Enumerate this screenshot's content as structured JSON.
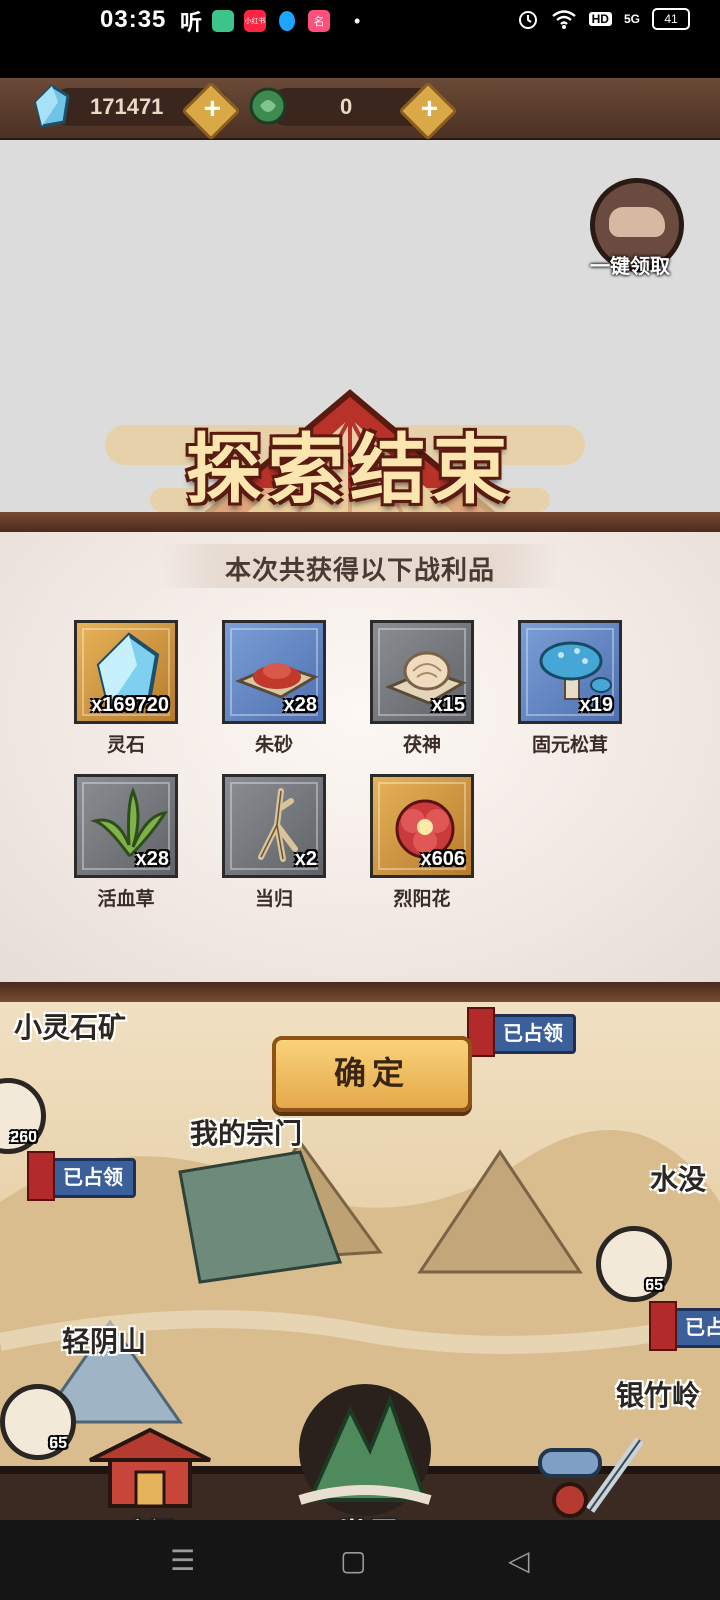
{
  "statusbar": {
    "time": "03:35",
    "listen_glyph": "听",
    "app_icons": [
      {
        "name": "green-app-icon",
        "color": "#3cc48a",
        "glyph": ""
      },
      {
        "name": "xiaohongshu-icon",
        "color": "#ff2442",
        "glyph": "小红书"
      },
      {
        "name": "qq-icon",
        "color": "#1ea5ff",
        "glyph": ""
      },
      {
        "name": "pink-app-icon",
        "color": "#ff4f7d",
        "glyph": "名"
      }
    ],
    "hd_label": "HD",
    "network": "5G",
    "battery": "41"
  },
  "resources": {
    "spirit_stone": "171471",
    "jade": "0",
    "plus": "+"
  },
  "collect_all_label": "一键领取",
  "modal": {
    "title": "探索结束",
    "subtitle": "本次共获得以下战利品",
    "confirm_label": "确定",
    "items": [
      {
        "name": "灵石",
        "qty": "x169720",
        "frame": "gold",
        "icon": "crystal-icon"
      },
      {
        "name": "朱砂",
        "qty": "x28",
        "frame": "blue",
        "icon": "cinnabar-icon"
      },
      {
        "name": "茯神",
        "qty": "x15",
        "frame": "gray",
        "icon": "fungus-icon"
      },
      {
        "name": "固元松茸",
        "qty": "x19",
        "frame": "blue",
        "icon": "mushroom-icon"
      },
      {
        "name": "活血草",
        "qty": "x28",
        "frame": "gray",
        "icon": "herb-icon"
      },
      {
        "name": "当归",
        "qty": "x2",
        "frame": "gray",
        "icon": "root-icon"
      },
      {
        "name": "烈阳花",
        "qty": "x606",
        "frame": "gold",
        "icon": "flower-icon"
      }
    ]
  },
  "map": {
    "labels": {
      "small_mine": "小灵石矿",
      "my_sect": "我的宗门",
      "light_yin_mountain": "轻阴山",
      "water": "水没",
      "silver_bamboo": "银竹岭"
    },
    "occupied": "已占领",
    "badge_left_top": "260",
    "badge_right": "65",
    "badge_left_bottom": "65"
  },
  "nav": {
    "sect": "宗门",
    "world": "世界",
    "disciple": "弟子"
  }
}
